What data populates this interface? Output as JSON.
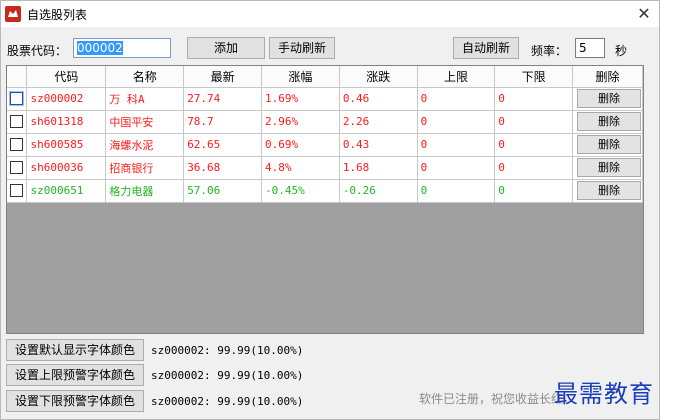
{
  "window": {
    "title": "自选股列表"
  },
  "toolbar": {
    "code_label": "股票代码：",
    "code_value": "000002",
    "add_label": "添加",
    "manual_refresh_label": "手动刷新",
    "auto_refresh_label": "自动刷新",
    "freq_label": "频率：",
    "freq_value": "5",
    "freq_unit": "秒"
  },
  "table": {
    "headers": [
      "代码",
      "名称",
      "最新",
      "涨幅",
      "涨跌",
      "上限",
      "下限",
      "删除"
    ],
    "rows": [
      {
        "code": "sz000002",
        "name": "万 科A",
        "latest": "27.74",
        "pct": "1.69%",
        "change": "0.46",
        "upper": "0",
        "lower": "0",
        "delete": "删除",
        "color": "red"
      },
      {
        "code": "sh601318",
        "name": "中国平安",
        "latest": "78.7",
        "pct": "2.96%",
        "change": "2.26",
        "upper": "0",
        "lower": "0",
        "delete": "删除",
        "color": "red"
      },
      {
        "code": "sh600585",
        "name": "海螺水泥",
        "latest": "62.65",
        "pct": "0.69%",
        "change": "0.43",
        "upper": "0",
        "lower": "0",
        "delete": "删除",
        "color": "red"
      },
      {
        "code": "sh600036",
        "name": "招商银行",
        "latest": "36.68",
        "pct": "4.8%",
        "change": "1.68",
        "upper": "0",
        "lower": "0",
        "delete": "删除",
        "color": "red"
      },
      {
        "code": "sz000651",
        "name": "格力电器",
        "latest": "57.06",
        "pct": "-0.45%",
        "change": "-0.26",
        "upper": "0",
        "lower": "0",
        "delete": "删除",
        "color": "green"
      }
    ]
  },
  "bottom": {
    "default_font_label": "设置默认显示字体颜色",
    "upper_alert_label": "设置上限预警字体颜色",
    "lower_alert_label": "设置下限预警字体颜色",
    "preview_text": "sz000002: 99.99(10.00%)",
    "status_text": "软件已注册，祝您收益长红"
  },
  "watermark": "最需教育",
  "colors": {
    "up": "#ff1a1a",
    "down": "#23b523",
    "accent": "#3399ff"
  },
  "icons": {
    "app": "app-logo-icon",
    "close": "close-icon"
  }
}
